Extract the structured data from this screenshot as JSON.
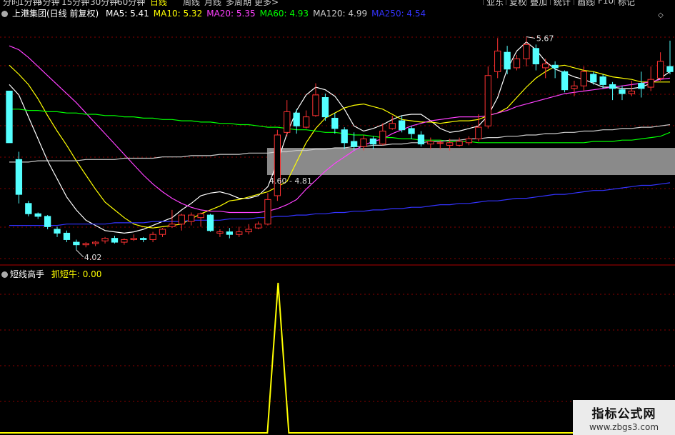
{
  "toolbar": {
    "timeframes": [
      "分时",
      "1分钟",
      "5分钟",
      "15分钟",
      "30分钟",
      "60分钟",
      "日线",
      "周线",
      "月线",
      "多周期",
      "更多>"
    ],
    "active_timeframe": "日线",
    "buttons": [
      "业东",
      "复权",
      "叠加",
      "统计",
      "画线",
      "F10",
      "标记"
    ]
  },
  "main_legend": {
    "title": "上港集团(日线 前复权)",
    "ma": [
      {
        "label": "MA5: 5.41",
        "color": "#ffffff"
      },
      {
        "label": "MA10: 5.32",
        "color": "#ffff00"
      },
      {
        "label": "MA20: 5.35",
        "color": "#ff40ff"
      },
      {
        "label": "MA60: 4.93",
        "color": "#00ff00"
      },
      {
        "label": "MA120: 4.99",
        "color": "#cccccc"
      },
      {
        "label": "MA250: 4.54",
        "color": "#3333ff"
      }
    ]
  },
  "annotations": {
    "high": "5.67",
    "low": "4.02",
    "zone": "4.60 - 4.81"
  },
  "sub_legend": {
    "title": "短线高手",
    "indicator": "抓短牛: 0.00"
  },
  "watermark": {
    "line1": "指标公式网",
    "line2": "www.zbgs3.com"
  },
  "colors": {
    "up": "#ff3232",
    "down": "#54ffff",
    "ma5": "#ffffff",
    "ma10": "#ffff00",
    "ma20": "#ff40ff",
    "ma60": "#00ff00",
    "ma120": "#cccccc",
    "ma250": "#3333ff",
    "signal": "#ffff00"
  },
  "chart_data": {
    "type": "candlestick",
    "series": [
      {
        "name": "MA5",
        "values": [
          5.3,
          5.22,
          5.05,
          4.88,
          4.71,
          4.57,
          4.43,
          4.33,
          4.25,
          4.21,
          4.17,
          4.16,
          4.15,
          4.16,
          4.18,
          4.21,
          4.24,
          4.27,
          4.33,
          4.38,
          4.44,
          4.46,
          4.47,
          4.45,
          4.42,
          4.42,
          4.44,
          4.51,
          4.7,
          4.92,
          5.1,
          5.22,
          5.28,
          5.26,
          5.21,
          5.11,
          4.98,
          4.94,
          4.96,
          4.99,
          5.03,
          5.06,
          5.07,
          5.07,
          5.02,
          4.96,
          4.93,
          4.94,
          4.96,
          4.98,
          5.06,
          5.2,
          5.42,
          5.56,
          5.63,
          5.57,
          5.48,
          5.42,
          5.39,
          5.36,
          5.34,
          5.31,
          5.28,
          5.28,
          5.27,
          5.27,
          5.28,
          5.31,
          5.35,
          5.4
        ]
      },
      {
        "name": "MA10",
        "values": [
          5.45,
          5.38,
          5.3,
          5.19,
          5.06,
          4.94,
          4.83,
          4.71,
          4.6,
          4.49,
          4.39,
          4.33,
          4.27,
          4.22,
          4.2,
          4.19,
          4.2,
          4.21,
          4.22,
          4.26,
          4.3,
          4.33,
          4.36,
          4.4,
          4.41,
          4.43,
          4.45,
          4.47,
          4.51,
          4.55,
          4.7,
          4.85,
          4.96,
          5.04,
          5.08,
          5.12,
          5.14,
          5.15,
          5.13,
          5.11,
          5.07,
          5.03,
          5.02,
          5.01,
          5.01,
          5.0,
          5.01,
          5.02,
          5.02,
          5.03,
          5.06,
          5.08,
          5.12,
          5.2,
          5.28,
          5.35,
          5.4,
          5.44,
          5.45,
          5.43,
          5.41,
          5.4,
          5.38,
          5.36,
          5.35,
          5.34,
          5.32,
          5.32,
          5.32,
          5.32
        ]
      },
      {
        "name": "MA20",
        "values": [
          5.6,
          5.57,
          5.51,
          5.44,
          5.37,
          5.3,
          5.23,
          5.16,
          5.08,
          5.0,
          4.92,
          4.84,
          4.76,
          4.68,
          4.6,
          4.53,
          4.47,
          4.42,
          4.38,
          4.35,
          4.33,
          4.32,
          4.32,
          4.31,
          4.31,
          4.31,
          4.31,
          4.32,
          4.34,
          4.37,
          4.41,
          4.49,
          4.56,
          4.63,
          4.69,
          4.74,
          4.79,
          4.83,
          4.86,
          4.88,
          4.92,
          4.95,
          4.98,
          5.0,
          5.02,
          5.03,
          5.04,
          5.05,
          5.05,
          5.05,
          5.06,
          5.08,
          5.1,
          5.13,
          5.15,
          5.17,
          5.19,
          5.21,
          5.23,
          5.24,
          5.25,
          5.26,
          5.27,
          5.28,
          5.29,
          5.3,
          5.31,
          5.32,
          5.34,
          5.35
        ]
      },
      {
        "name": "MA60",
        "values": [
          5.11,
          5.11,
          5.1,
          5.1,
          5.09,
          5.09,
          5.08,
          5.08,
          5.07,
          5.07,
          5.06,
          5.06,
          5.05,
          5.05,
          5.04,
          5.04,
          5.03,
          5.03,
          5.02,
          5.02,
          5.01,
          5.01,
          5.0,
          5.0,
          4.99,
          4.99,
          4.98,
          4.97,
          4.97,
          4.96,
          4.95,
          4.95,
          4.94,
          4.93,
          4.93,
          4.92,
          4.91,
          4.91,
          4.9,
          4.89,
          4.89,
          4.88,
          4.88,
          4.87,
          4.87,
          4.87,
          4.86,
          4.86,
          4.86,
          4.85,
          4.85,
          4.85,
          4.85,
          4.85,
          4.85,
          4.85,
          4.85,
          4.85,
          4.85,
          4.85,
          4.85,
          4.86,
          4.86,
          4.86,
          4.87,
          4.87,
          4.88,
          4.89,
          4.9,
          4.93
        ]
      },
      {
        "name": "MA120",
        "values": [
          4.7,
          4.7,
          4.7,
          4.71,
          4.71,
          4.71,
          4.71,
          4.71,
          4.72,
          4.72,
          4.72,
          4.72,
          4.73,
          4.73,
          4.73,
          4.73,
          4.74,
          4.74,
          4.74,
          4.75,
          4.75,
          4.75,
          4.76,
          4.76,
          4.76,
          4.77,
          4.77,
          4.77,
          4.78,
          4.78,
          4.79,
          4.79,
          4.8,
          4.8,
          4.81,
          4.81,
          4.82,
          4.82,
          4.83,
          4.83,
          4.84,
          4.84,
          4.85,
          4.85,
          4.86,
          4.86,
          4.87,
          4.87,
          4.88,
          4.88,
          4.89,
          4.89,
          4.9,
          4.9,
          4.91,
          4.91,
          4.92,
          4.92,
          4.93,
          4.93,
          4.94,
          4.94,
          4.95,
          4.95,
          4.96,
          4.96,
          4.97,
          4.97,
          4.98,
          4.99
        ]
      },
      {
        "name": "MA250",
        "values": [
          4.21,
          4.21,
          4.21,
          4.21,
          4.21,
          4.21,
          4.22,
          4.22,
          4.22,
          4.22,
          4.22,
          4.23,
          4.23,
          4.23,
          4.23,
          4.24,
          4.24,
          4.24,
          4.24,
          4.25,
          4.25,
          4.25,
          4.25,
          4.26,
          4.26,
          4.26,
          4.27,
          4.27,
          4.28,
          4.28,
          4.29,
          4.29,
          4.3,
          4.3,
          4.31,
          4.31,
          4.32,
          4.32,
          4.33,
          4.33,
          4.34,
          4.34,
          4.35,
          4.35,
          4.36,
          4.37,
          4.37,
          4.38,
          4.38,
          4.39,
          4.4,
          4.4,
          4.41,
          4.42,
          4.42,
          4.43,
          4.44,
          4.45,
          4.45,
          4.46,
          4.47,
          4.48,
          4.48,
          4.49,
          4.5,
          4.51,
          4.52,
          4.52,
          4.53,
          4.54
        ]
      }
    ],
    "candles": [
      [
        5.25,
        4.85,
        5.25,
        4.85
      ],
      [
        4.72,
        4.45,
        4.78,
        4.38
      ],
      [
        4.38,
        4.3,
        4.4,
        4.28
      ],
      [
        4.3,
        4.28,
        4.31,
        4.26
      ],
      [
        4.28,
        4.2,
        4.29,
        4.18
      ],
      [
        4.18,
        4.15,
        4.2,
        4.12
      ],
      [
        4.15,
        4.1,
        4.17,
        4.08
      ],
      [
        4.08,
        4.06,
        4.1,
        4.02
      ],
      [
        4.06,
        4.07,
        4.08,
        4.04
      ],
      [
        4.07,
        4.08,
        4.09,
        4.05
      ],
      [
        4.09,
        4.11,
        4.12,
        4.07
      ],
      [
        4.11,
        4.08,
        4.13,
        4.07
      ],
      [
        4.08,
        4.1,
        4.11,
        4.06
      ],
      [
        4.1,
        4.11,
        4.14,
        4.09
      ],
      [
        4.11,
        4.1,
        4.12,
        4.08
      ],
      [
        4.1,
        4.14,
        4.16,
        4.08
      ],
      [
        4.14,
        4.18,
        4.19,
        4.12
      ],
      [
        4.2,
        4.22,
        4.33,
        4.19
      ],
      [
        4.22,
        4.29,
        4.3,
        4.17
      ],
      [
        4.24,
        4.29,
        4.31,
        4.21
      ],
      [
        4.27,
        4.3,
        4.31,
        4.2
      ],
      [
        4.29,
        4.17,
        4.3,
        4.16
      ],
      [
        4.15,
        4.16,
        4.18,
        4.12
      ],
      [
        4.16,
        4.14,
        4.19,
        4.11
      ],
      [
        4.14,
        4.16,
        4.2,
        4.12
      ],
      [
        4.16,
        4.18,
        4.22,
        4.14
      ],
      [
        4.19,
        4.22,
        4.24,
        4.18
      ],
      [
        4.22,
        4.41,
        4.46,
        4.21
      ],
      [
        4.44,
        4.91,
        4.95,
        4.4
      ],
      [
        4.93,
        5.09,
        5.18,
        4.9
      ],
      [
        5.08,
        4.98,
        5.11,
        4.92
      ],
      [
        4.97,
        5.05,
        5.1,
        4.96
      ],
      [
        5.06,
        5.22,
        5.31,
        5.05
      ],
      [
        5.2,
        5.05,
        5.23,
        5.02
      ],
      [
        5.04,
        4.96,
        5.08,
        4.92
      ],
      [
        4.95,
        4.85,
        4.97,
        4.8
      ],
      [
        4.86,
        4.82,
        4.93,
        4.79
      ],
      [
        4.82,
        4.88,
        4.91,
        4.79
      ],
      [
        4.88,
        4.84,
        4.9,
        4.8
      ],
      [
        4.84,
        4.94,
        5.0,
        4.83
      ],
      [
        4.96,
        5.0,
        5.06,
        4.95
      ],
      [
        5.02,
        4.95,
        5.06,
        4.93
      ],
      [
        4.96,
        4.92,
        4.98,
        4.88
      ],
      [
        4.91,
        4.84,
        4.94,
        4.82
      ],
      [
        4.84,
        4.86,
        4.89,
        4.8
      ],
      [
        4.85,
        4.85,
        4.87,
        4.8
      ],
      [
        4.83,
        4.85,
        4.88,
        4.79
      ],
      [
        4.83,
        4.86,
        4.89,
        4.82
      ],
      [
        4.85,
        4.88,
        4.9,
        4.83
      ],
      [
        4.88,
        4.97,
        5.07,
        4.86
      ],
      [
        4.98,
        5.37,
        5.44,
        4.96
      ],
      [
        5.4,
        5.56,
        5.66,
        5.35
      ],
      [
        5.55,
        5.42,
        5.6,
        5.38
      ],
      [
        5.43,
        5.5,
        5.53,
        5.41
      ],
      [
        5.5,
        5.61,
        5.67,
        5.44
      ],
      [
        5.58,
        5.46,
        5.61,
        5.41
      ],
      [
        5.43,
        5.46,
        5.5,
        5.35
      ],
      [
        5.45,
        5.43,
        5.48,
        5.35
      ],
      [
        5.4,
        5.26,
        5.41,
        5.24
      ],
      [
        5.27,
        5.29,
        5.33,
        5.21
      ],
      [
        5.29,
        5.4,
        5.44,
        5.25
      ],
      [
        5.38,
        5.32,
        5.4,
        5.3
      ],
      [
        5.36,
        5.3,
        5.38,
        5.27
      ],
      [
        5.3,
        5.27,
        5.32,
        5.18
      ],
      [
        5.26,
        5.23,
        5.29,
        5.18
      ],
      [
        5.23,
        5.25,
        5.33,
        5.21
      ],
      [
        5.31,
        5.27,
        5.4,
        5.2
      ],
      [
        5.28,
        5.34,
        5.44,
        5.25
      ],
      [
        5.35,
        5.48,
        5.55,
        5.33
      ],
      [
        5.44,
        5.4,
        5.64,
        5.38
      ]
    ],
    "candle_fields": [
      "open",
      "close",
      "high",
      "low"
    ],
    "indicator": {
      "name": "抓短牛",
      "signal_index": 28,
      "value": 0.0
    }
  }
}
